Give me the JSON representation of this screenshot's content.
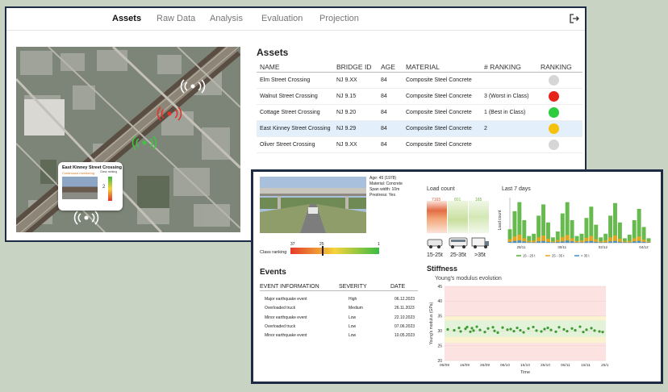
{
  "nav": {
    "tabs": [
      "Assets",
      "Raw Data",
      "Analysis",
      "Evaluation",
      "Projection"
    ],
    "active": 0
  },
  "map_popup": {
    "title": "East Kinney Street Crossing",
    "subtitle": "Continuous monitoring",
    "class_label": "Class ranking",
    "value": "2"
  },
  "assets": {
    "title": "Assets",
    "columns": [
      "NAME",
      "BRIDGE ID",
      "AGE",
      "MATERIAL",
      "# RANKING",
      "RANKING"
    ],
    "rows": [
      {
        "name": "Elm Street Crossing",
        "id": "NJ 9.XX",
        "age": "84",
        "material": "Composite Steel Concrete",
        "rank_text": "",
        "color": "#d6d6d6"
      },
      {
        "name": "Walnut Street Crossing",
        "id": "NJ 9.15",
        "age": "84",
        "material": "Composite Steel Concrete",
        "rank_text": "3 (Worst in Class)",
        "color": "#e5231b"
      },
      {
        "name": "Cottage Street Crossing",
        "id": "NJ 9.20",
        "age": "84",
        "material": "Composite Steel Concrete",
        "rank_text": "1 (Best in Class)",
        "color": "#2ecc3f"
      },
      {
        "name": "East Kinney Street Crossing",
        "id": "NJ 9.29",
        "age": "84",
        "material": "Composite Steel Concrete",
        "rank_text": "2",
        "color": "#f5c20b"
      },
      {
        "name": "Oliver Street Crossing",
        "id": "NJ 9.XX",
        "age": "84",
        "material": "Composite Steel Concrete",
        "rank_text": "",
        "color": "#d6d6d6"
      }
    ],
    "selected_index": 3
  },
  "detail": {
    "info": [
      "Age: 45 (1978)",
      "Material: Concrete",
      "Span width: 10m",
      "Prestress: Yes"
    ],
    "class_ranking": {
      "label": "Class ranking",
      "min": "37",
      "mid": "25",
      "max": "1",
      "position": 0.35
    },
    "events": {
      "title": "Events",
      "columns": [
        "EVENT INFORMATION",
        "SEVERITY",
        "DATE"
      ],
      "rows": [
        {
          "info": "Major earthquake event",
          "severity": "High",
          "date": "06.12.2023"
        },
        {
          "info": "Overloaded truck",
          "severity": "Medium",
          "date": "26.11.2023"
        },
        {
          "info": "Minor earthquake event",
          "severity": "Low",
          "date": "22.10.2023"
        },
        {
          "info": "Overloaded truck",
          "severity": "Low",
          "date": "07.06.2023"
        },
        {
          "info": "Minor earthquake event",
          "severity": "Low",
          "date": "10.05.2023"
        }
      ]
    },
    "load_count": {
      "title": "Load count",
      "values": [
        "7165",
        "801",
        "165"
      ],
      "labels": [
        "15-25t",
        "25-35t",
        ">35t"
      ],
      "colors": [
        "#d9573b",
        "#7bb84a",
        "#5fa83c"
      ]
    }
  },
  "chart_data": [
    {
      "type": "area",
      "title": "Last 7 days",
      "ylabel": "Load count",
      "x_ticks": [
        "28/11",
        "30/11",
        "02/12",
        "04/12"
      ],
      "y_ticks": [],
      "legend": {
        "placement": "bottom"
      },
      "series": [
        {
          "name": "15 - 25 t",
          "color": "#4caf2f",
          "values": [
            0.3,
            0.7,
            0.9,
            0.5,
            0.15,
            0.2,
            0.6,
            0.85,
            0.45,
            0.12,
            0.25,
            0.65,
            0.9,
            0.5,
            0.15,
            0.2,
            0.55,
            0.8,
            0.4,
            0.12,
            0.2,
            0.6,
            0.88,
            0.45,
            0.1,
            0.18,
            0.5,
            0.75,
            0.35,
            0.1
          ]
        },
        {
          "name": "25 - 35 t",
          "color": "#f0a51c",
          "values": [
            0.08,
            0.14,
            0.18,
            0.1,
            0.04,
            0.05,
            0.12,
            0.16,
            0.09,
            0.03,
            0.06,
            0.13,
            0.17,
            0.1,
            0.04,
            0.05,
            0.11,
            0.15,
            0.08,
            0.03,
            0.05,
            0.12,
            0.16,
            0.09,
            0.03,
            0.04,
            0.1,
            0.14,
            0.07,
            0.03
          ]
        },
        {
          "name": "> 35 t",
          "color": "#3b8fd6",
          "values": [
            0.02,
            0.04,
            0.05,
            0.03,
            0.01,
            0.01,
            0.03,
            0.04,
            0.02,
            0.01,
            0.02,
            0.03,
            0.05,
            0.03,
            0.01,
            0.01,
            0.03,
            0.04,
            0.02,
            0.01,
            0.01,
            0.03,
            0.04,
            0.02,
            0.01,
            0.01,
            0.03,
            0.04,
            0.02,
            0.01
          ]
        }
      ]
    },
    {
      "type": "scatter",
      "title": "Stiffness",
      "subtitle": "Young's modulus evolution",
      "xlabel": "Time",
      "ylabel": "Young's modulus (GPa)",
      "ylim": [
        20,
        45
      ],
      "y_ticks": [
        20,
        25,
        30,
        35,
        40,
        45
      ],
      "x_ticks": [
        "06/09",
        "16/09",
        "26/09",
        "06/10",
        "16/10",
        "26/10",
        "05/11",
        "15/11",
        "25/11"
      ],
      "bands": [
        {
          "from": 20,
          "to": 35,
          "color": "#fde2e2"
        },
        {
          "from": 33.5,
          "to": 35,
          "color": "#fbf2cf"
        },
        {
          "from": 26,
          "to": 33.5,
          "color": "#e3f3da"
        },
        {
          "from": 26,
          "to": 28,
          "color": "#fbf2cf"
        },
        {
          "from": 35,
          "to": 45,
          "color": "#fde2e2"
        }
      ],
      "series": [
        {
          "color": "#3e9a33",
          "x": [
            0.02,
            0.06,
            0.09,
            0.1,
            0.13,
            0.14,
            0.16,
            0.17,
            0.18,
            0.2,
            0.22,
            0.25,
            0.27,
            0.3,
            0.31,
            0.33,
            0.36,
            0.39,
            0.41,
            0.43,
            0.45,
            0.47,
            0.49,
            0.52,
            0.55,
            0.57,
            0.6,
            0.62,
            0.64,
            0.66,
            0.69,
            0.71,
            0.74,
            0.76,
            0.79,
            0.81,
            0.84,
            0.86,
            0.88,
            0.91,
            0.93,
            0.96,
            0.98
          ],
          "y": [
            30.5,
            30.2,
            31,
            29.8,
            30.7,
            31.3,
            29.7,
            30.9,
            30.1,
            31.4,
            30.3,
            29.6,
            30.8,
            31.2,
            30,
            29.4,
            31.1,
            30.4,
            30.6,
            29.9,
            31,
            30.2,
            29.5,
            30.8,
            31.3,
            30.1,
            29.8,
            30.6,
            31,
            30.3,
            29.7,
            31.2,
            30.5,
            29.9,
            30.8,
            30.2,
            31.4,
            29.6,
            30.4,
            30.9,
            30.1,
            29.8,
            29.6
          ]
        }
      ]
    }
  ]
}
